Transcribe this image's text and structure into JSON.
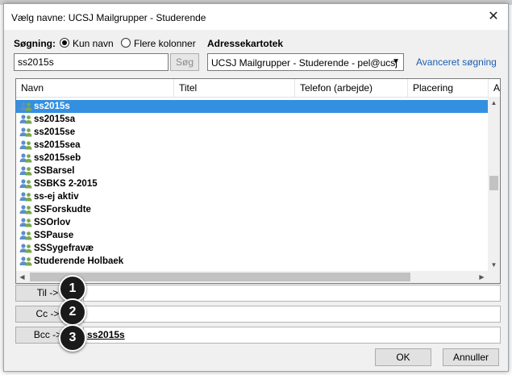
{
  "window": {
    "title": "Vælg navne: UCSJ Mailgrupper - Studerende"
  },
  "search": {
    "label": "Søgning:",
    "option_name": "Kun navn",
    "option_more": "Flere kolonner",
    "value": "ss2015s",
    "button": "Søg"
  },
  "address_book": {
    "label": "Adressekartotek",
    "selected": "UCSJ Mailgrupper - Studerende - pel@ucsj",
    "advanced_link": "Avanceret søgning"
  },
  "list": {
    "columns": [
      "Navn",
      "Titel",
      "Telefon (arbejde)",
      "Placering",
      "Af"
    ],
    "rows": [
      "ss2015s",
      "ss2015sa",
      "ss2015se",
      "ss2015sea",
      "ss2015seb",
      "SSBarsel",
      "SSBKS 2-2015",
      "ss-ej aktiv",
      "SSForskudte",
      "SSOrlov",
      "SSPause",
      "SSSygefravæ",
      "Studerende Holbaek"
    ],
    "selected_index": 0
  },
  "recipients": {
    "to_label": "Til ->",
    "cc_label": "Cc ->",
    "bcc_label": "Bcc ->",
    "to_value": "",
    "cc_value": "",
    "bcc_value": "ss2015s"
  },
  "markers": [
    "1",
    "2",
    "3"
  ],
  "buttons": {
    "ok": "OK",
    "cancel": "Annuller"
  },
  "colors": {
    "selection": "#3390e0",
    "link": "#1a5fb4"
  }
}
